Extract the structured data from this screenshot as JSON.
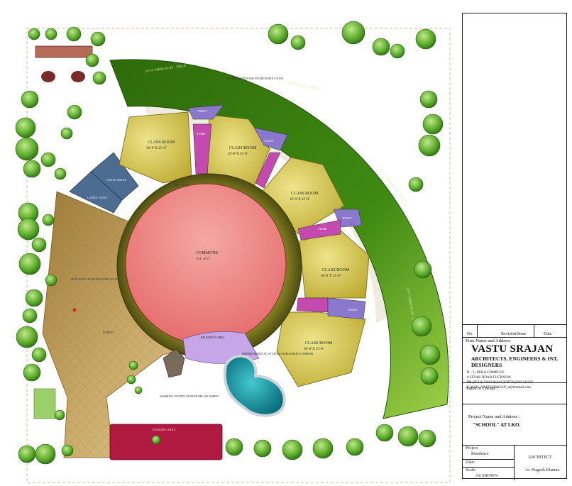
{
  "title_block": {
    "rev_headers": [
      "No.",
      "Revision/Issue",
      "Date"
    ],
    "firm_heading": "Firm Name and Address",
    "firm_name": "VASTU SRAJAN",
    "firm_tagline": "ARCHITECTS, ENGINEERS & INT. DESIGNERS",
    "firm_addr_1": "B – 1, NEHA COMPLEX",
    "firm_addr_2": "8 SEVAK ROAD LUCKNOW.",
    "firm_phone": "PH-(0522)-2346230,9415634730,9335242507",
    "firm_email": "E-MAIL: VASTUSRAJAN_tt@hotmail.com",
    "owner_label": "Name of Owner :",
    "project_label": "Project Name and Address :",
    "project_name": "\"SCHOOL\" AT LKO.",
    "project_field_label": "Project",
    "project_field_value": "Residence",
    "date_label": "Date:",
    "scale_label": "Scale:",
    "scale_value": "AS SHOWN",
    "architect_label": "ARCHITECT",
    "architect_name": "Ar. Pragesh Khanna"
  },
  "plan_labels": {
    "play_field_1": "15'-0\" WIDE PLAY - FIELD",
    "play_field_2": "15'-0\" WIDE PLAY - FIELD",
    "play_field_3": "15'-0\" WIDE PLAY - FIELD",
    "play_field_4": "15'-0\" WIDE PLAY - FIELD",
    "covered_zone": "COVERED OUTDOOR ENVIRONMENT ZONE",
    "classroom": "CLASS ROOM",
    "classroom_size": "30'-0\"X 25'-0\"",
    "toilet": "TOILET",
    "gents_toilet": "GENTS TOILET",
    "ladies_toilet": "LADIES TOILET",
    "store": "STORE",
    "multipurpose_stage": "MULTIPURPOSE STAGE",
    "commons": "COMMONS",
    "commons_level": "LVL +0'-0\"",
    "outer_level": "LVL. + 3'-0\"",
    "skylight": "SKYLIGHT/CLEAR BUILDING AT 2ND LEVEL",
    "porch": "PORCH",
    "reception": "RECEPTION AREA",
    "administration": "ADMINISTRATION AT 1ST LEVEL OVERLOOKING COMMONS",
    "warming": "WARMING PANTRY STATION BELOW ADMIN",
    "parking": "PARKING AREA"
  },
  "colors": {
    "play_field": "#3f8a12",
    "classroom": "#d4c43c",
    "commons": "#f08a86",
    "ring": "#6d6a14",
    "toilet": "#8a78cc",
    "store": "#c44ab0",
    "porch": "#b89554",
    "pool": "#0e8f9c",
    "parking": "#b01a40",
    "tree": "#3d8a20"
  }
}
